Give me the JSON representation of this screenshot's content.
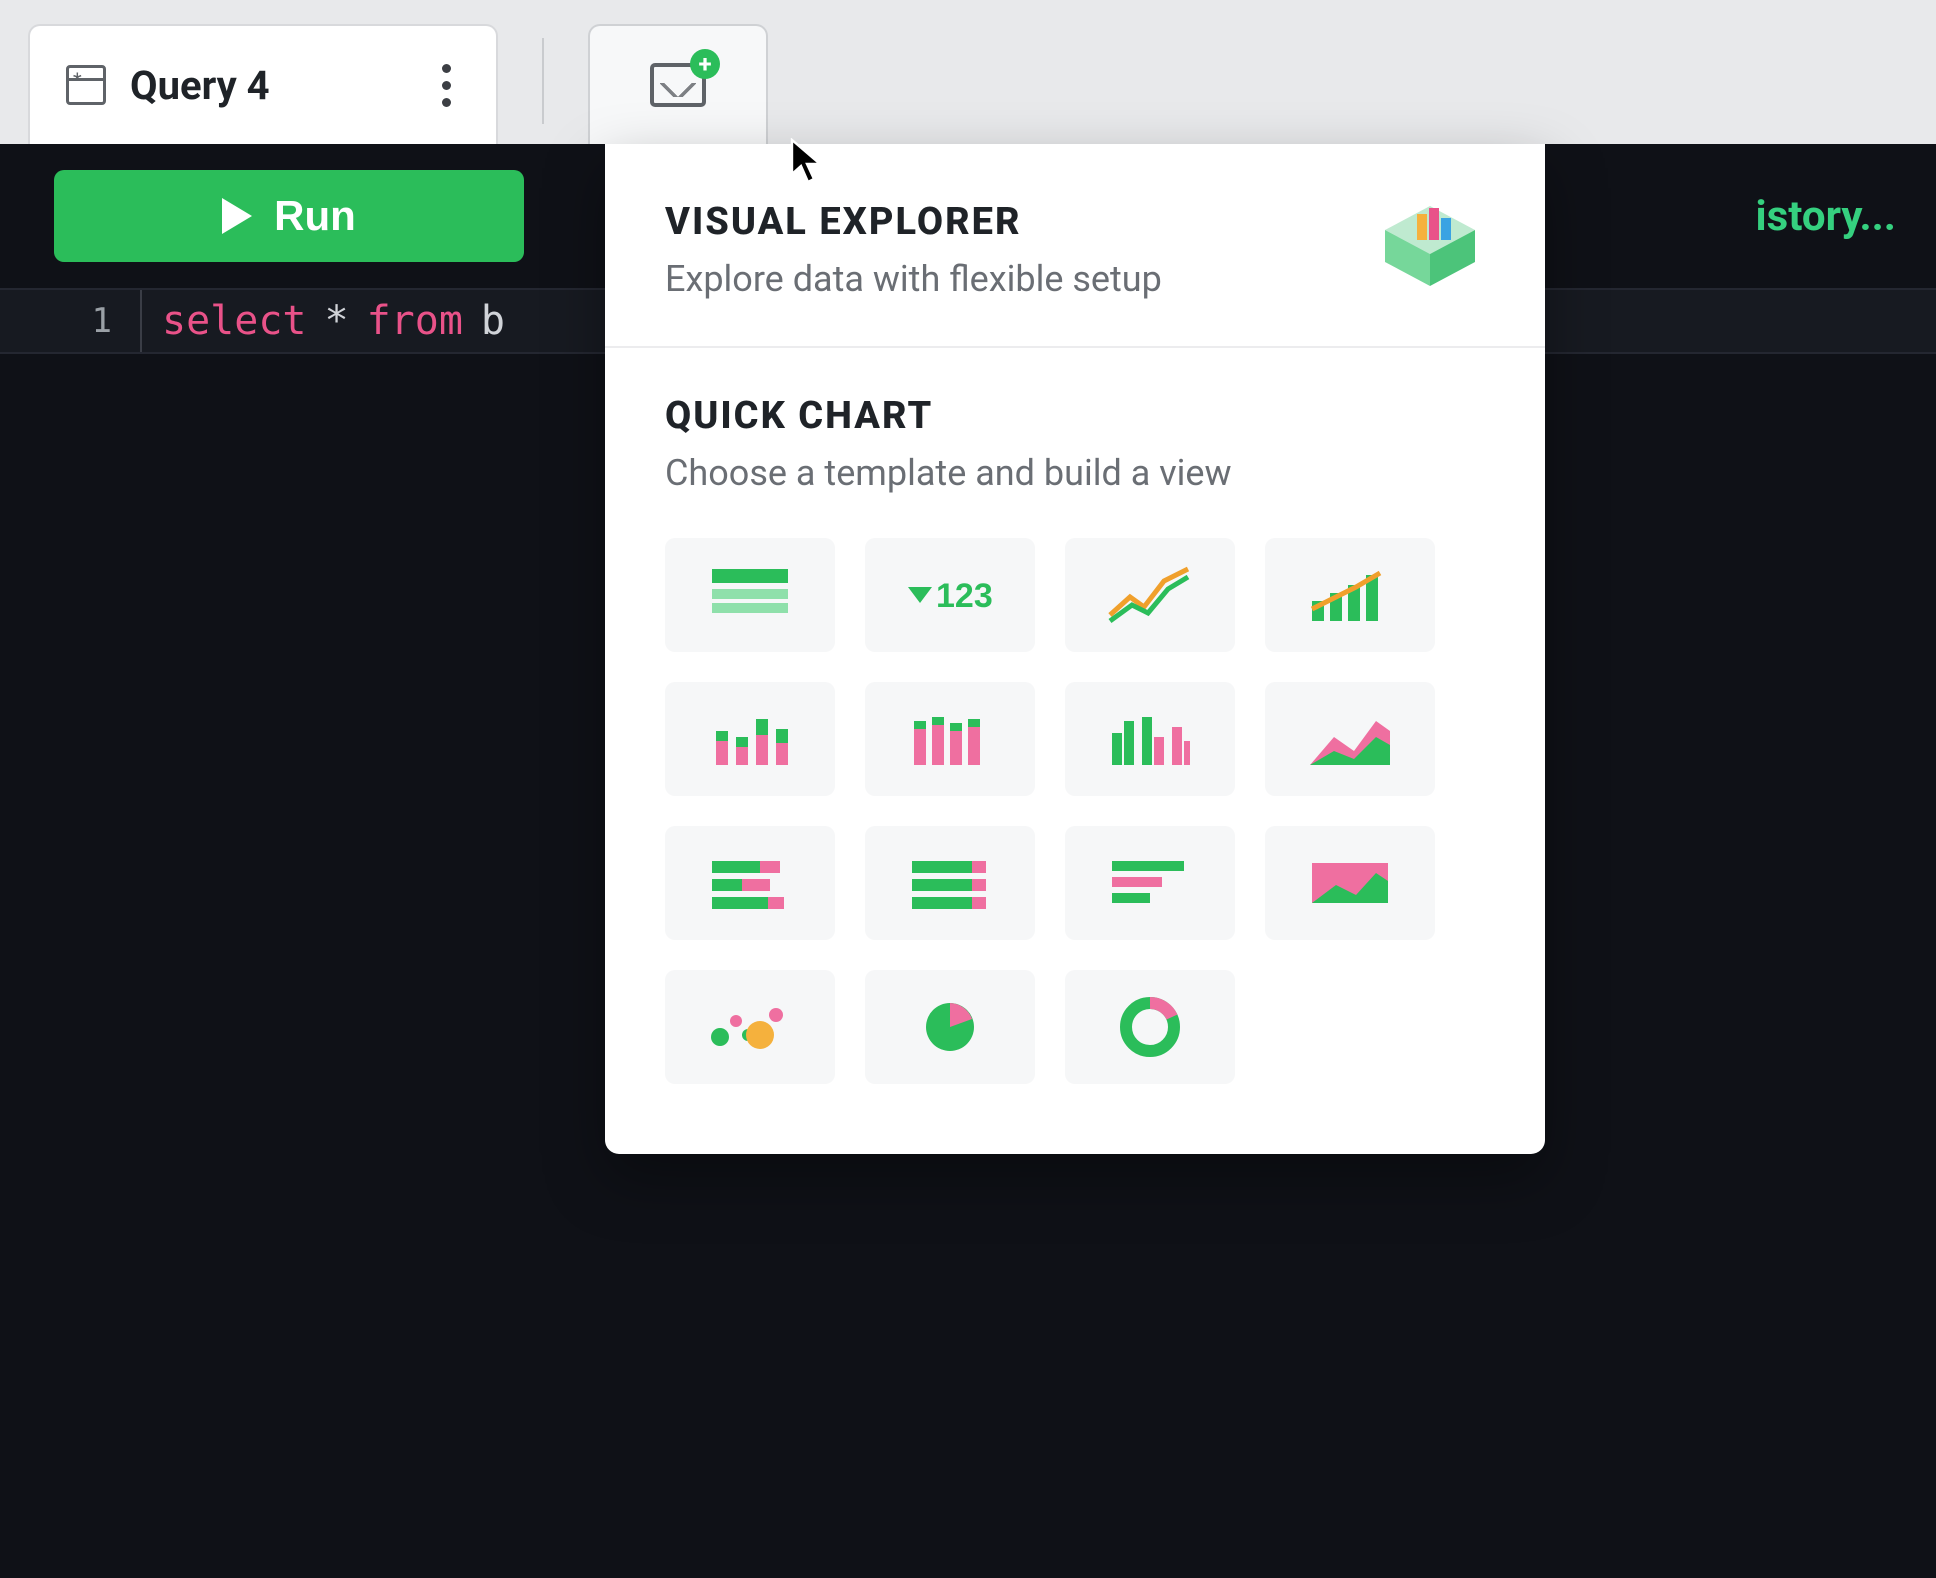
{
  "tab": {
    "label": "Query 4"
  },
  "toolbar": {
    "run_label": "Run",
    "history_label": "istory..."
  },
  "editor": {
    "line_no": "1",
    "token_select": "select",
    "token_star": "*",
    "token_from": "from",
    "token_rest": "b"
  },
  "panel": {
    "visual_explorer": {
      "title": "VISUAL EXPLORER",
      "subtitle": "Explore data with flexible setup"
    },
    "quick_chart": {
      "title": "QUICK CHART",
      "subtitle": "Choose a template and build a view",
      "big_number_label": "123"
    },
    "chart_types": [
      "table",
      "big-number",
      "line",
      "bar-line",
      "column-stacked",
      "column-grouped",
      "column-clustered",
      "area",
      "horizontal-bar-a",
      "horizontal-bar-b",
      "horizontal-bar-c",
      "combo-area",
      "scatter",
      "pie",
      "donut"
    ]
  }
}
